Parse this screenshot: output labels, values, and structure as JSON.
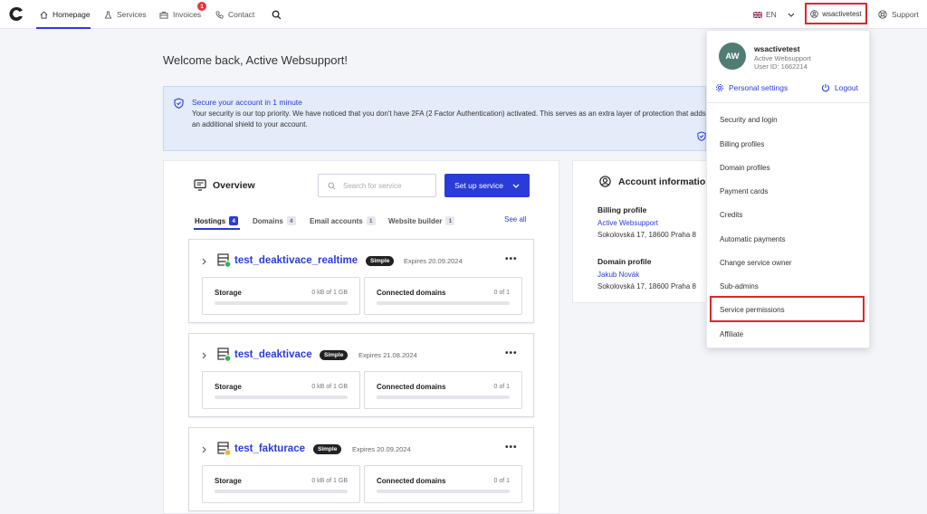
{
  "nav": {
    "homepage": "Homepage",
    "services": "Services",
    "invoices": "Invoices",
    "invoices_badge": "1",
    "contact": "Contact",
    "language": "EN",
    "username": "wsactivetest",
    "support": "Support"
  },
  "welcome": "Welcome back, Active Websupport!",
  "alert": {
    "title": "Secure your account in 1 minute",
    "text": "Your security is our top priority. We have noticed that you don't have 2FA (2 Factor Authentication) activated. This serves as an extra layer of protection that adds an additional shield to your account."
  },
  "overview": {
    "title": "Overview",
    "search_placeholder": "Search for service",
    "setup_label": "Set up service",
    "tabs": [
      {
        "label": "Hostings",
        "count": "4"
      },
      {
        "label": "Domains",
        "count": "4"
      },
      {
        "label": "Email accounts",
        "count": "1"
      },
      {
        "label": "Website builder",
        "count": "1"
      }
    ],
    "see_all": "See all",
    "hostings": [
      {
        "name": "test_deaktivace_realtime",
        "plan": "Simple",
        "expires": "Expires 20.09.2024",
        "status_color": "#2fb350",
        "storage_label": "Storage",
        "storage_value": "0 kB of 1 GB",
        "domains_label": "Connected domains",
        "domains_value": "0 of 1"
      },
      {
        "name": "test_deaktivace",
        "plan": "Simple",
        "expires": "Expires 21.08.2024",
        "status_color": "#2fb350",
        "storage_label": "Storage",
        "storage_value": "0 kB of 1 GB",
        "domains_label": "Connected domains",
        "domains_value": "0 of 1"
      },
      {
        "name": "test_fakturace",
        "plan": "Simple",
        "expires": "Expires 20.09.2024",
        "status_color": "#f0b429",
        "storage_label": "Storage",
        "storage_value": "0 kB of 1 GB",
        "domains_label": "Connected domains",
        "domains_value": "0 of 1"
      }
    ]
  },
  "account": {
    "title": "Account information",
    "billing_title": "Billing profile",
    "billing_name": "Active Websupport",
    "billing_address": "Sokolovská 17, 18600 Praha 8",
    "domain_title": "Domain profile",
    "domain_name": "Jakub Novák",
    "domain_address": "Sokolovská 17, 18600 Praha 8"
  },
  "dropdown": {
    "initials": "AW",
    "username": "wsactivetest",
    "org": "Active Websupport",
    "user_id": "User ID: 1662214",
    "personal_settings": "Personal settings",
    "logout": "Logout",
    "items": [
      "Security and login",
      "Billing profiles",
      "Domain profiles",
      "Payment cards",
      "Credits",
      "Automatic payments",
      "Change service owner",
      "Sub-admins",
      "Service permissions",
      "Affiliate"
    ]
  },
  "colors": {
    "accent": "#2b3bd8",
    "highlight": "#e0262c"
  }
}
